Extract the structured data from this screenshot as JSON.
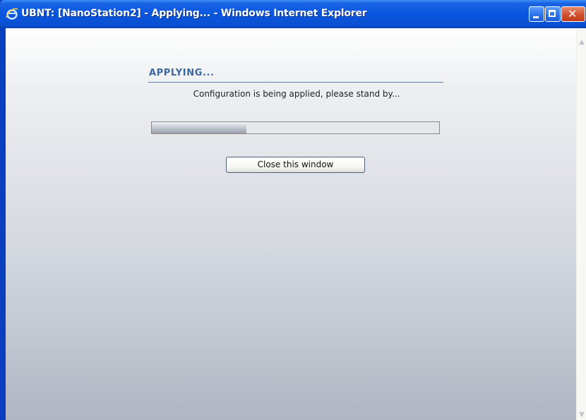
{
  "window": {
    "title": "UBNT: [NanoStation2] - Applying... - Windows Internet Explorer",
    "close_glyph": "✕"
  },
  "page": {
    "heading": "APPLYING...",
    "message": "Configuration is being applied, please stand by...",
    "progress_fraction": 0.33,
    "close_button_label": "Close this window"
  },
  "icons": {
    "app": "internet-explorer-icon",
    "scroll_up": "scroll-up-arrow-icon",
    "scroll_down": "scroll-down-arrow-icon"
  },
  "colors": {
    "titlebar": "#0957e0",
    "heading": "#3c67a1",
    "close": "#d1522e"
  }
}
